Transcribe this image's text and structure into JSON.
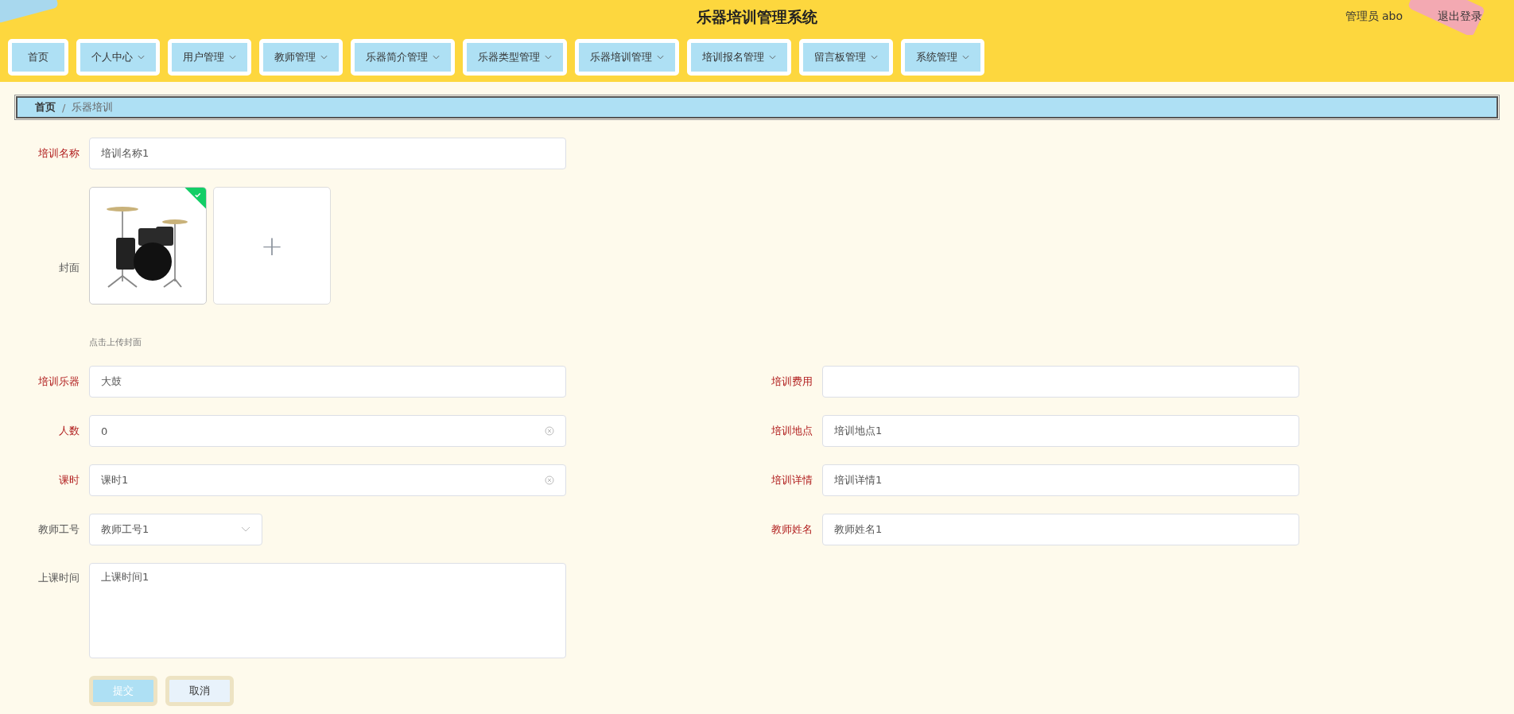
{
  "header": {
    "title": "乐器培训管理系统",
    "user": "管理员 abo",
    "logout": "退出登录"
  },
  "nav": [
    {
      "label": "首页",
      "has_dropdown": false
    },
    {
      "label": "个人中心",
      "has_dropdown": true
    },
    {
      "label": "用户管理",
      "has_dropdown": true
    },
    {
      "label": "教师管理",
      "has_dropdown": true
    },
    {
      "label": "乐器简介管理",
      "has_dropdown": true
    },
    {
      "label": "乐器类型管理",
      "has_dropdown": true
    },
    {
      "label": "乐器培训管理",
      "has_dropdown": true
    },
    {
      "label": "培训报名管理",
      "has_dropdown": true
    },
    {
      "label": "留言板管理",
      "has_dropdown": true
    },
    {
      "label": "系统管理",
      "has_dropdown": true
    }
  ],
  "breadcrumb": [
    "首页",
    "乐器培训"
  ],
  "breadcrumb_separator": "/",
  "form": {
    "name_field": {
      "label": "培训名称",
      "required": true,
      "value": "培训名称1"
    },
    "cover": {
      "label": "封面",
      "uploaded": true,
      "hint": "点击上传封面",
      "add_symbol": "+"
    },
    "pairs": [
      [
        {
          "label": "培训乐器",
          "required": true,
          "kind": "input",
          "value": "大鼓",
          "clearable": false
        },
        {
          "label": "培训费用",
          "required": true,
          "kind": "input",
          "clearable": false
        }
      ],
      [
        {
          "label": "人数",
          "required": true,
          "kind": "input",
          "value": "0",
          "clearable": true
        },
        {
          "label": "培训地点",
          "required": true,
          "kind": "input",
          "value": "培训地点1",
          "clearable": false
        }
      ],
      [
        {
          "label": "课时",
          "required": true,
          "kind": "input",
          "value": "课时1",
          "clearable": true
        },
        {
          "label": "培训详情",
          "required": true,
          "kind": "input",
          "value": "培训详情1",
          "clearable": false
        }
      ],
      [
        {
          "label": "教师工号",
          "required": false,
          "kind": "select",
          "value": "教师工号1",
          "clearable": false
        },
        {
          "label": "教师姓名",
          "required": true,
          "kind": "input",
          "value": "教师姓名1",
          "clearable": false
        }
      ]
    ],
    "time_field": {
      "label": "上课时间",
      "required": false,
      "value": "上课时间1"
    },
    "buttons": [
      {
        "label": "提交",
        "kind": "primary",
        "disabled": true
      },
      {
        "label": "取消",
        "kind": "default",
        "disabled": false
      }
    ]
  }
}
